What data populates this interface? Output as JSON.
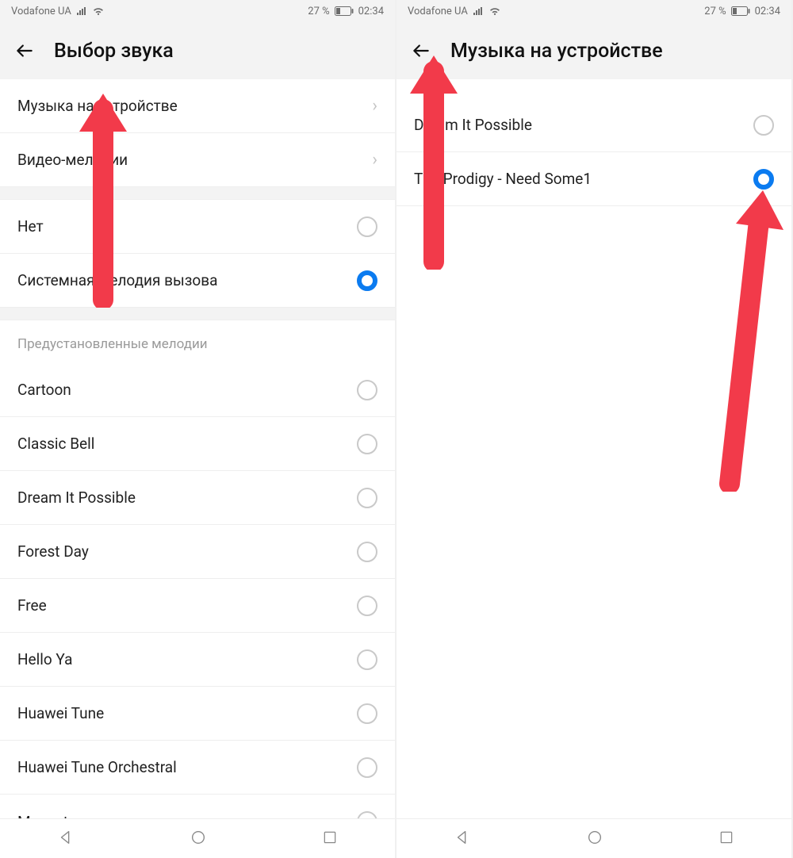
{
  "status": {
    "carrier": "Vodafone UA",
    "battery_text": "27 %",
    "time": "02:34"
  },
  "left": {
    "title": "Выбор звука",
    "nav_items": [
      {
        "label": "Музыка на устройстве"
      },
      {
        "label": "Видео-мелодии"
      }
    ],
    "system_items": [
      {
        "label": "Нет",
        "selected": false
      },
      {
        "label": "Системная мелодия вызова",
        "selected": true
      }
    ],
    "section_header": "Предустановленные мелодии",
    "preset_items": [
      {
        "label": "Cartoon",
        "selected": false
      },
      {
        "label": "Classic Bell",
        "selected": false
      },
      {
        "label": "Dream It Possible",
        "selected": false
      },
      {
        "label": "Forest Day",
        "selected": false
      },
      {
        "label": "Free",
        "selected": false
      },
      {
        "label": "Hello Ya",
        "selected": false
      },
      {
        "label": "Huawei Tune",
        "selected": false
      },
      {
        "label": "Huawei Tune Orchestral",
        "selected": false
      },
      {
        "label": "Menuet",
        "selected": false
      }
    ]
  },
  "right": {
    "title": "Музыка на устройстве",
    "items": [
      {
        "label": "Dream It Possible",
        "selected": false
      },
      {
        "label": "The Prodigy - Need Some1",
        "selected": true
      }
    ]
  },
  "colors": {
    "accent": "#0b7bf0",
    "arrow": "#f23a4a"
  }
}
